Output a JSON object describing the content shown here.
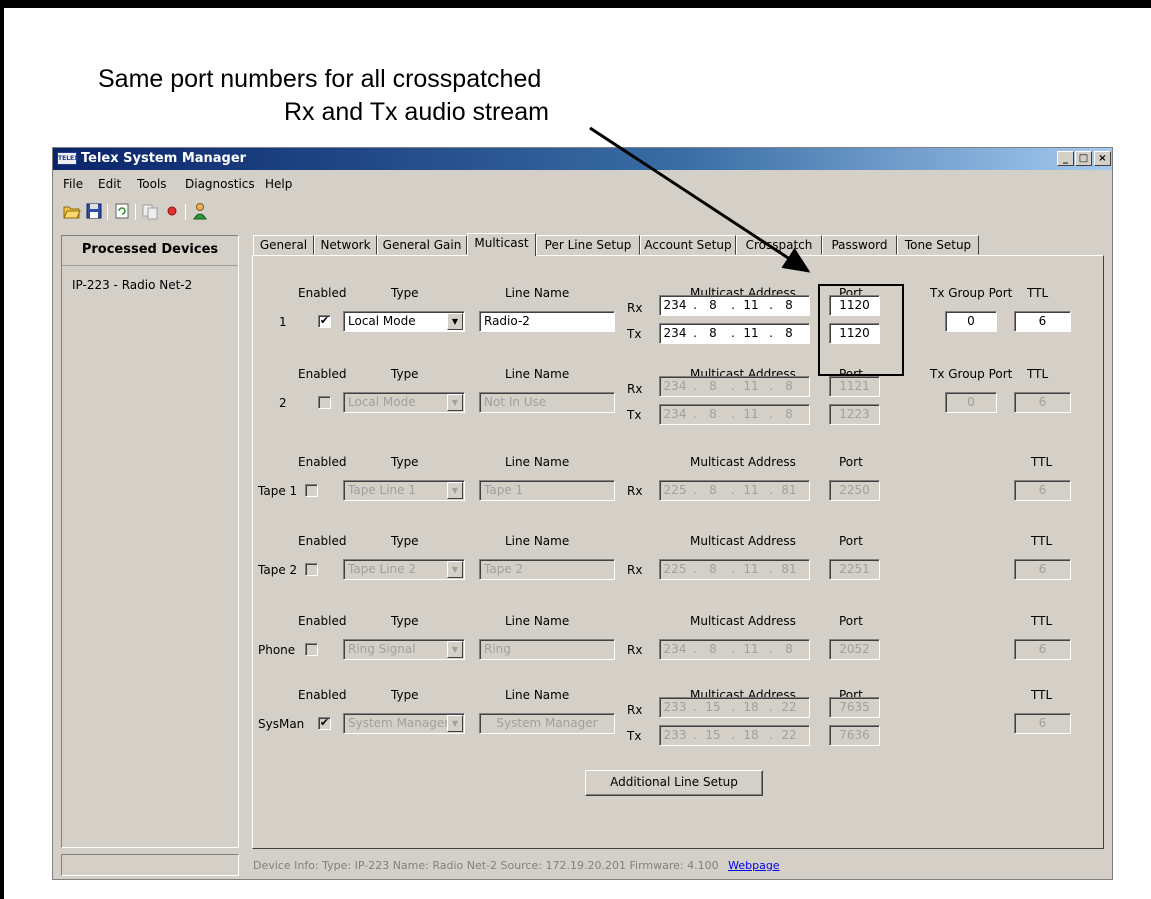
{
  "annotation": {
    "line1": "Same port numbers for all crosspatched",
    "line2": "Rx and Tx audio stream"
  },
  "window": {
    "title": "Telex System Manager",
    "icon_text": "TELEX",
    "controls": [
      "_",
      "□",
      "×"
    ]
  },
  "menu": [
    "File",
    "Edit",
    "Tools",
    "Diagnostics",
    "Help"
  ],
  "toolbar_icons": [
    "open-folder-icon",
    "save-icon",
    "refresh-icon",
    "copy-icon",
    "record-icon",
    "user-icon"
  ],
  "sidebar": {
    "header": "Processed Devices",
    "items": [
      "IP-223 - Radio Net-2"
    ]
  },
  "tabs": [
    "General",
    "Network",
    "General Gain",
    "Multicast",
    "Per Line Setup",
    "Account Setup",
    "Crosspatch",
    "Password",
    "Tone Setup"
  ],
  "active_tab": "Multicast",
  "headers": {
    "enabled": "Enabled",
    "type": "Type",
    "line_name": "Line Name",
    "multicast_address": "Multicast Address",
    "port": "Port",
    "tx_group_port": "Tx Group Port",
    "ttl": "TTL"
  },
  "rx_label": "Rx",
  "tx_label": "Tx",
  "lines": [
    {
      "label": "1",
      "checked": true,
      "enabled": true,
      "type": "Local Mode",
      "line_name": "Radio-2",
      "rx_addr": [
        "234",
        "8",
        "11",
        "8"
      ],
      "rx_port": "1120",
      "tx_addr": [
        "234",
        "8",
        "11",
        "8"
      ],
      "tx_port": "1120",
      "tx_group_port": "0",
      "ttl": "6"
    },
    {
      "label": "2",
      "checked": false,
      "enabled": false,
      "type": "Local Mode",
      "line_name": "Not In Use",
      "rx_addr": [
        "234",
        "8",
        "11",
        "8"
      ],
      "rx_port": "1121",
      "tx_addr": [
        "234",
        "8",
        "11",
        "8"
      ],
      "tx_port": "1223",
      "tx_group_port": "0",
      "ttl": "6"
    },
    {
      "label": "Tape 1",
      "checked": false,
      "enabled": false,
      "type": "Tape Line 1",
      "line_name": "Tape 1",
      "rx_addr": [
        "225",
        "8",
        "11",
        "81"
      ],
      "rx_port": "2250",
      "ttl": "6"
    },
    {
      "label": "Tape 2",
      "checked": false,
      "enabled": false,
      "type": "Tape Line 2",
      "line_name": "Tape 2",
      "rx_addr": [
        "225",
        "8",
        "11",
        "81"
      ],
      "rx_port": "2251",
      "ttl": "6"
    },
    {
      "label": "Phone",
      "checked": false,
      "enabled": false,
      "type": "Ring Signal",
      "line_name": "Ring",
      "rx_addr": [
        "234",
        "8",
        "11",
        "8"
      ],
      "rx_port": "2052",
      "ttl": "6"
    },
    {
      "label": "SysMan",
      "checked": true,
      "enabled": false,
      "type": "System Manager",
      "line_name": "System Manager",
      "rx_addr": [
        "233",
        "15",
        "18",
        "22"
      ],
      "rx_port": "7635",
      "tx_addr": [
        "233",
        "15",
        "18",
        "22"
      ],
      "tx_port": "7636",
      "ttl": "6"
    }
  ],
  "additional_button": "Additional Line Setup",
  "device_info": {
    "text": "Device Info:  Type: IP-223  Name: Radio Net-2  Source: 172.19.20.201  Firmware: 4.100",
    "link": "Webpage"
  }
}
